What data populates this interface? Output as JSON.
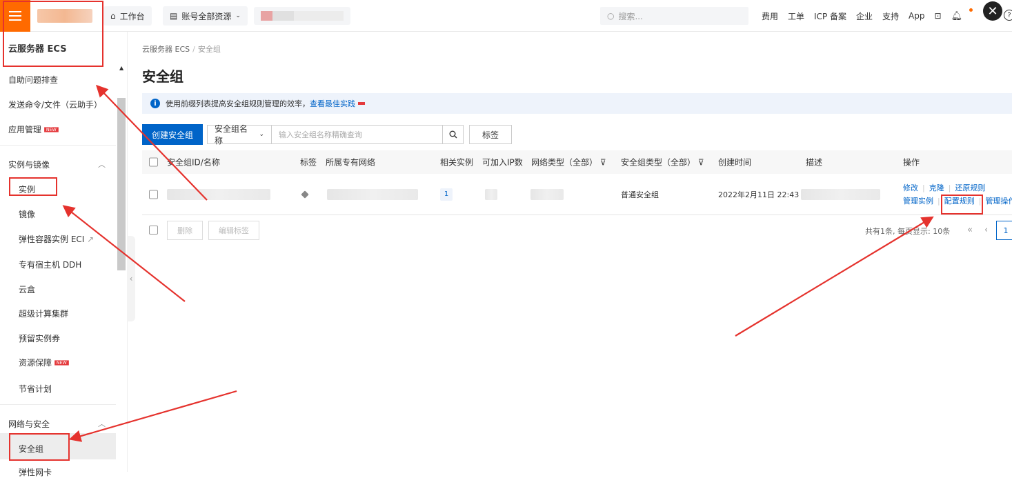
{
  "topbar": {
    "workbench": "工作台",
    "resource_selector": "账号全部资源",
    "search_placeholder": "搜索...",
    "links": [
      "费用",
      "工单",
      "ICP 备案",
      "企业",
      "支持",
      "App"
    ]
  },
  "sidebar": {
    "title": "云服务器 ECS",
    "top_items": [
      {
        "label": "自助问题排查"
      },
      {
        "label": "发送命令/文件（云助手）"
      },
      {
        "label": "应用管理",
        "badge": "NEW"
      }
    ],
    "group1": {
      "label": "实例与镜像",
      "items": [
        {
          "label": "实例"
        },
        {
          "label": "镜像"
        },
        {
          "label": "弹性容器实例 ECI"
        },
        {
          "label": "专有宿主机 DDH"
        },
        {
          "label": "云盒"
        },
        {
          "label": "超级计算集群"
        },
        {
          "label": "预留实例券"
        },
        {
          "label": "资源保障",
          "badge": "NEW"
        },
        {
          "label": "节省计划"
        }
      ]
    },
    "group2": {
      "label": "网络与安全",
      "items": [
        {
          "label": "安全组"
        },
        {
          "label": "弹性网卡"
        }
      ]
    }
  },
  "main": {
    "breadcrumb": [
      "云服务器 ECS",
      "安全组"
    ],
    "title": "安全组",
    "notice": {
      "text": "使用前缀列表提高安全组规则管理的效率，",
      "link": "查看最佳实践"
    },
    "toolbar": {
      "create_button": "创建安全组",
      "search_field": "安全组名称",
      "search_placeholder": "输入安全组名称精确查询",
      "tags_button": "标签"
    },
    "table": {
      "columns": [
        "安全组ID/名称",
        "标签",
        "所属专有网络",
        "相关实例",
        "可加入IP数",
        "网络类型（全部）",
        "安全组类型（全部）",
        "创建时间",
        "描述",
        "操作"
      ],
      "rows": [
        {
          "related_instances": "1",
          "sg_type": "普通安全组",
          "created": "2022年2月11日 22:43",
          "actions_row1": [
            "修改",
            "克隆",
            "还原规则"
          ],
          "actions_row2": [
            "管理实例",
            "配置规则",
            "管理操作"
          ]
        }
      ]
    },
    "footer": {
      "delete_button": "删除",
      "edit_tags_button": "编辑标签",
      "pager_text": "共有1条, 每页显示: 10条",
      "current_page": "1"
    }
  },
  "colors": {
    "brand": "#ff6a00",
    "primary": "#0064c8",
    "annotation": "#e5322d"
  }
}
